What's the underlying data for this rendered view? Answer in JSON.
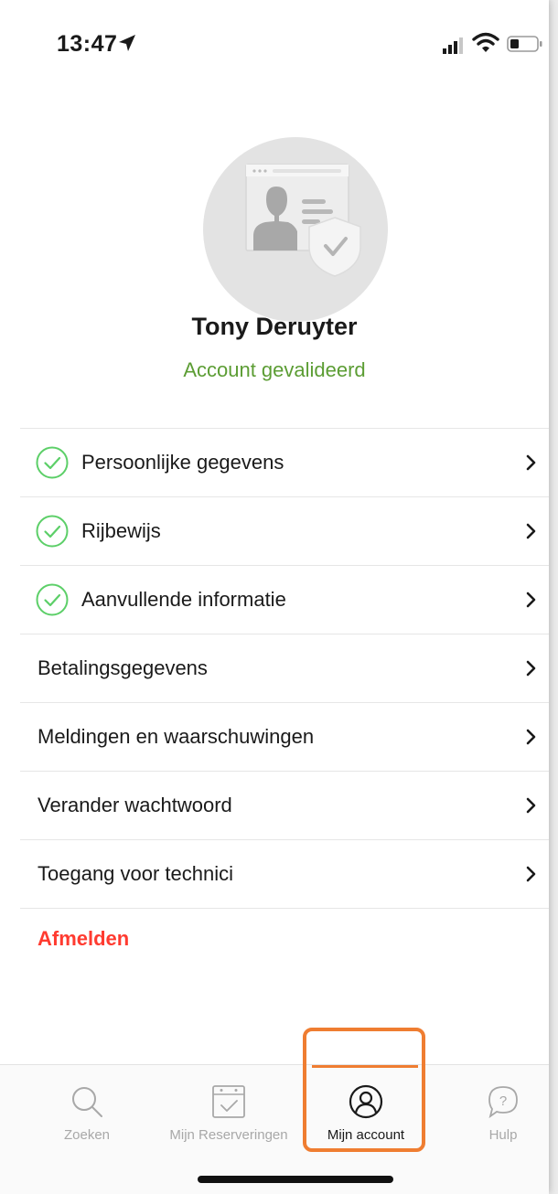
{
  "status_bar": {
    "time": "13:47"
  },
  "profile": {
    "name": "Tony Deruyter",
    "status": "Account gevalideerd"
  },
  "menu": {
    "items": [
      {
        "label": "Persoonlijke gegevens",
        "validated": true
      },
      {
        "label": "Rijbewijs",
        "validated": true
      },
      {
        "label": "Aanvullende informatie",
        "validated": true
      },
      {
        "label": "Betalingsgegevens",
        "validated": false
      },
      {
        "label": "Meldingen en waarschuwingen",
        "validated": false
      },
      {
        "label": "Verander wachtwoord",
        "validated": false
      },
      {
        "label": "Toegang voor technici",
        "validated": false
      }
    ],
    "logout_label": "Afmelden"
  },
  "tab_bar": {
    "tabs": [
      {
        "label": "Zoeken",
        "icon": "search-icon"
      },
      {
        "label": "Mijn Reserveringen",
        "icon": "calendar-check-icon"
      },
      {
        "label": "Mijn account",
        "icon": "user-circle-icon",
        "active": true
      },
      {
        "label": "Hulp",
        "icon": "help-bubble-icon"
      }
    ]
  },
  "colors": {
    "validated_green": "#5c9d34",
    "logout_red": "#ff3b30",
    "highlight_orange": "#ef7d31"
  }
}
